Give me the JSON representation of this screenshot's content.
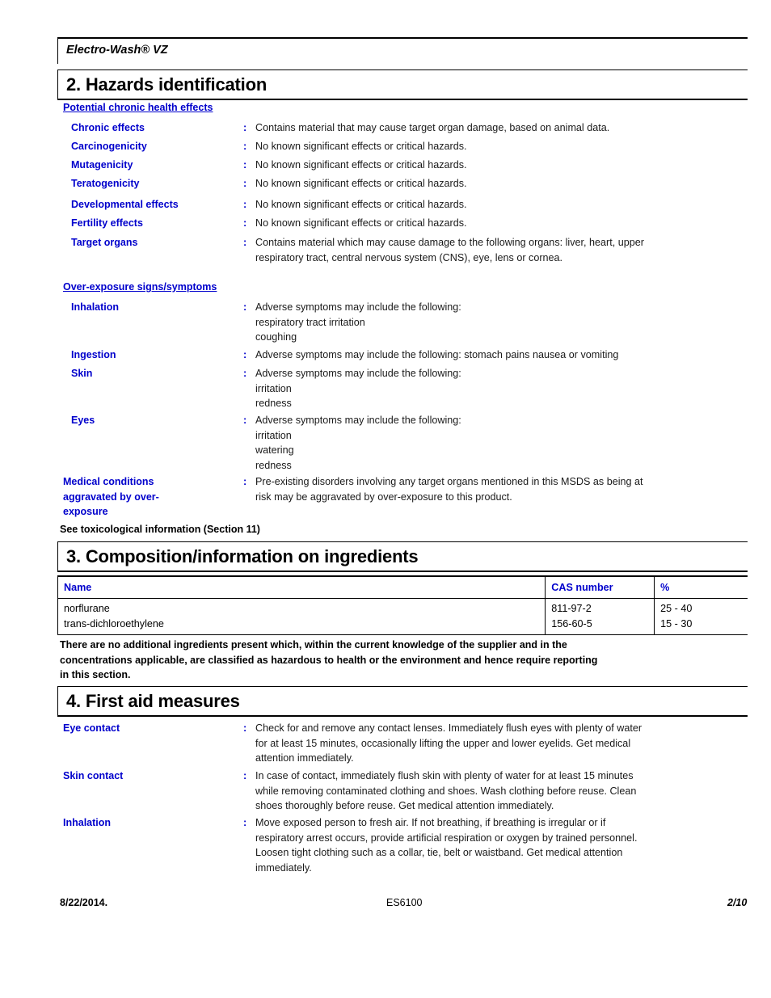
{
  "document": {
    "product_title": "Electro-Wash® VZ",
    "footer": {
      "date": "8/22/2014.",
      "product_code": "ES6100",
      "page_number": "2/10"
    }
  },
  "section2": {
    "heading": "2. Hazards identification",
    "chronic_group_heading": "Potential chronic health effects",
    "colon": ":",
    "chronic_rows": [
      {
        "label": "Chronic effects",
        "value": "Contains material that may cause target organ damage, based on animal data."
      },
      {
        "label": "Carcinogenicity",
        "value": "No known significant effects or critical hazards."
      },
      {
        "label": "Mutagenicity",
        "value": "No known significant effects or critical hazards."
      },
      {
        "label": "Teratogenicity",
        "value": "No known significant effects or critical hazards."
      },
      {
        "label": "Developmental effects",
        "value": "No known significant effects or critical hazards."
      },
      {
        "label": "Fertility effects",
        "value": "No known significant effects or critical hazards."
      },
      {
        "label": "Target organs",
        "value": "Contains material which may cause damage to the following organs: liver, heart, upper\nrespiratory tract, central nervous system (CNS), eye, lens or cornea."
      }
    ],
    "overexposure_group_heading": "Over-exposure signs/symptoms",
    "overexposure_rows": [
      {
        "label": "Inhalation",
        "value": "Adverse symptoms may include the following:\nrespiratory tract irritation\ncoughing"
      },
      {
        "label": "Ingestion",
        "value": "Adverse symptoms may include the following: stomach pains nausea or vomiting"
      },
      {
        "label": "Skin",
        "value": "Adverse symptoms may include the following:\nirritation\nredness"
      },
      {
        "label": "Eyes",
        "value": "Adverse symptoms may include the following:\nirritation\nwatering\nredness"
      },
      {
        "label": "Medical conditions\naggravated by over-\nexposure",
        "value": "Pre-existing disorders involving any target organs mentioned in this MSDS as being at\nrisk may be aggravated by over-exposure to this product."
      }
    ],
    "see_toxicological_note": "See toxicological information (Section 11)"
  },
  "section3": {
    "heading": "3. Composition/information on ingredients",
    "table": {
      "columns": [
        "Name",
        "CAS number",
        "%"
      ],
      "rows": [
        {
          "name": "norflurane",
          "cas": "811-97-2",
          "percent": "25 - 40"
        },
        {
          "name": "trans-dichloroethylene",
          "cas": "156-60-5",
          "percent": "15 - 30"
        }
      ]
    },
    "note": "There are no additional ingredients present which, within the current knowledge of the supplier and in the\nconcentrations applicable, are classified as hazardous to health or the environment and hence require reporting\nin this section."
  },
  "section4": {
    "heading": "4. First aid measures",
    "rows": [
      {
        "label": "Eye contact",
        "value": "Check for and remove any contact lenses.  Immediately flush eyes with plenty of water\nfor at least 15 minutes, occasionally lifting the upper and lower eyelids.  Get medical\nattention immediately."
      },
      {
        "label": "Skin contact",
        "value": "In case of contact, immediately flush skin with plenty of water for at least 15 minutes\nwhile removing contaminated clothing and shoes.  Wash clothing before reuse.  Clean\nshoes thoroughly before reuse.  Get medical attention immediately."
      },
      {
        "label": "Inhalation",
        "value": "Move exposed person to fresh air.  If not breathing, if breathing is irregular or if\nrespiratory arrest occurs, provide artificial respiration or oxygen by trained personnel.\nLoosen tight clothing such as a collar, tie, belt or waistband.  Get medical attention\nimmediately."
      }
    ]
  },
  "colors": {
    "heading_blue": "#0000CC",
    "body_text": "#1a1a1a",
    "rule": "#000000"
  }
}
